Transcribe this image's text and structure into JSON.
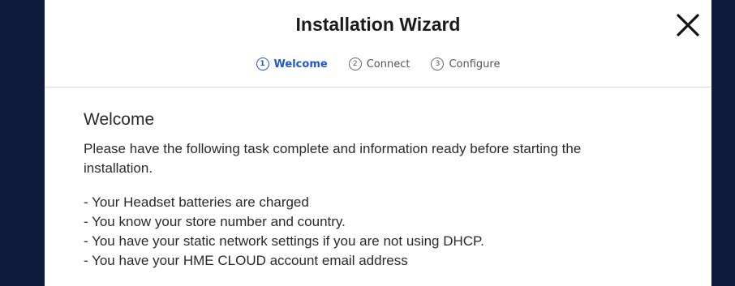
{
  "wizard": {
    "title": "Installation Wizard",
    "steps": [
      {
        "number": "1",
        "label": "Welcome",
        "active": true
      },
      {
        "number": "2",
        "label": "Connect",
        "active": false
      },
      {
        "number": "3",
        "label": "Configure",
        "active": false
      }
    ]
  },
  "content": {
    "heading": "Welcome",
    "intro": "Please have the following task complete and information ready before starting the installation.",
    "items": [
      "- Your Headset batteries are charged",
      "- You know your store number and country.",
      "- You have your static network settings if you are not using DHCP.",
      "- You have your HME CLOUD account email address"
    ]
  },
  "colors": {
    "backdrop": "#0d1b3d",
    "accent": "#1f56d6"
  }
}
